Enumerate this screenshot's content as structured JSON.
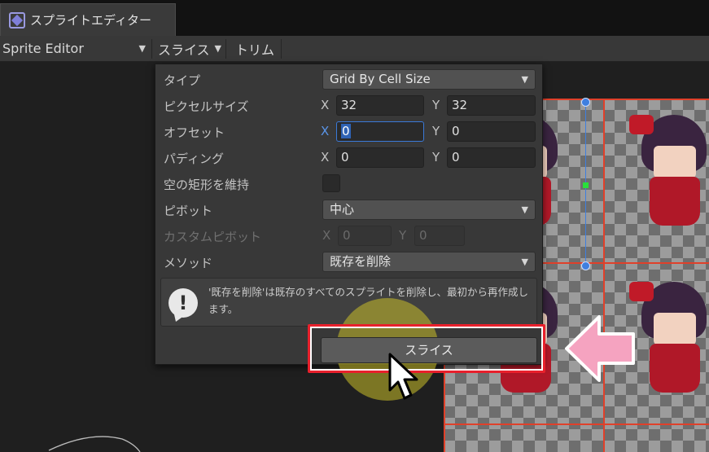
{
  "window": {
    "tab_title": "スプライトエディター",
    "tab_icon": "sprite-editor-icon"
  },
  "toolbar": {
    "mode_label": "Sprite Editor",
    "slice_menu_label": "スライス",
    "trim_label": "トリム"
  },
  "slice_popup": {
    "type": {
      "label": "タイプ",
      "value": "Grid By Cell Size"
    },
    "pixel_size": {
      "label": "ピクセルサイズ",
      "x_label": "X",
      "x": "32",
      "y_label": "Y",
      "y": "32"
    },
    "offset": {
      "label": "オフセット",
      "x_label": "X",
      "x": "0",
      "y_label": "Y",
      "y": "0"
    },
    "padding": {
      "label": "パディング",
      "x_label": "X",
      "x": "0",
      "y_label": "Y",
      "y": "0"
    },
    "keep_empty": {
      "label": "空の矩形を維持",
      "checked": false
    },
    "pivot": {
      "label": "ピボット",
      "value": "中心"
    },
    "custom_pivot": {
      "label": "カスタムピボット",
      "x_label": "X",
      "x": "0",
      "y_label": "Y",
      "y": "0",
      "disabled": true
    },
    "method": {
      "label": "メソッド",
      "value": "既存を削除"
    },
    "help_message": "'既存を削除'は既存のすべてのスプライトを削除し、最初から再作成します。",
    "slice_button_label": "スライス"
  },
  "colors": {
    "highlight_border": "#e8202c",
    "pink_arrow": "#f5a3c0",
    "cursor_glow": "#c8be28",
    "selection_blue": "#3f7fdf"
  }
}
